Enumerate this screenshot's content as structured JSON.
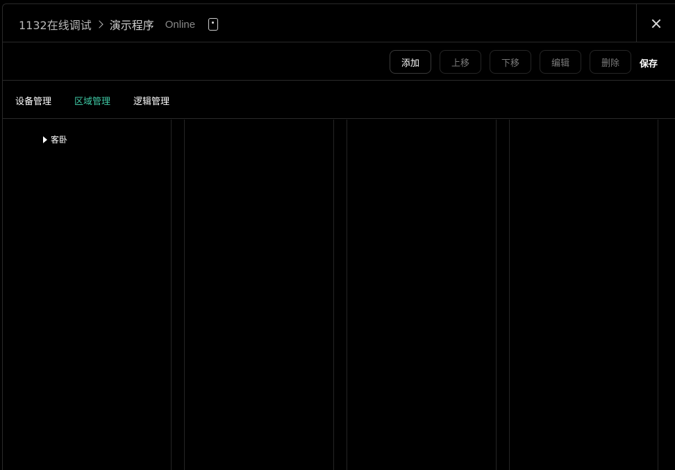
{
  "title": {
    "project": "1132在线调试",
    "program": "演示程序",
    "status": "Online",
    "device_icon": "tablet-icon",
    "close_icon": "close-icon"
  },
  "toolbar": {
    "add": "添加",
    "move_up": "上移",
    "move_down": "下移",
    "edit": "编辑",
    "delete": "删除",
    "save": "保存"
  },
  "tabs": [
    {
      "label": "设备管理",
      "active": false
    },
    {
      "label": "区域管理",
      "active": true
    },
    {
      "label": "逻辑管理",
      "active": false
    }
  ],
  "tree": {
    "items": [
      {
        "label": "客卧",
        "expanded": false
      }
    ]
  },
  "colors": {
    "accent": "#3ec7a3",
    "background": "#000000",
    "border": "#2a2a2a"
  }
}
